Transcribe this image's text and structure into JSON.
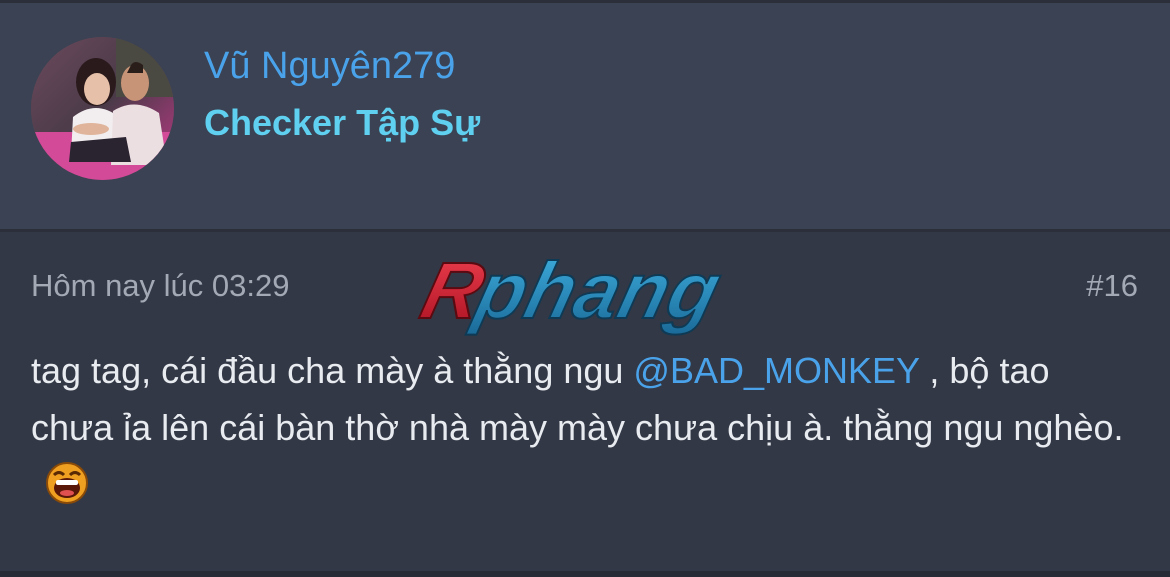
{
  "user": {
    "name": "Vũ Nguyên279",
    "title": "Checker Tập Sự",
    "avatar_icon": "user-avatar-photo"
  },
  "post": {
    "timestamp": "Hôm nay lúc 03:29",
    "number": "#16",
    "message": {
      "before_mention": "tag tag, cái đầu cha mày à thằng ngu ",
      "mention": "@BAD_MONKEY",
      "after_mention": " , bộ tao chưa ỉa lên cái bàn thờ nhà mày mày chưa chịu à. thằng ngu nghèo.",
      "emoji_icon": "laughing-emoji-icon"
    }
  },
  "watermark": {
    "text": "Rphang"
  },
  "colors": {
    "header_bg": "#3a4253",
    "body_bg": "#323845",
    "username": "#4aa3ea",
    "user_title": "#5fd0f0",
    "meta_text": "#a3a9b5",
    "message_text": "#e8ebf0",
    "mention": "#4aa3ea",
    "watermark_red": "#d42030",
    "watermark_blue": "#2a8fc0"
  }
}
